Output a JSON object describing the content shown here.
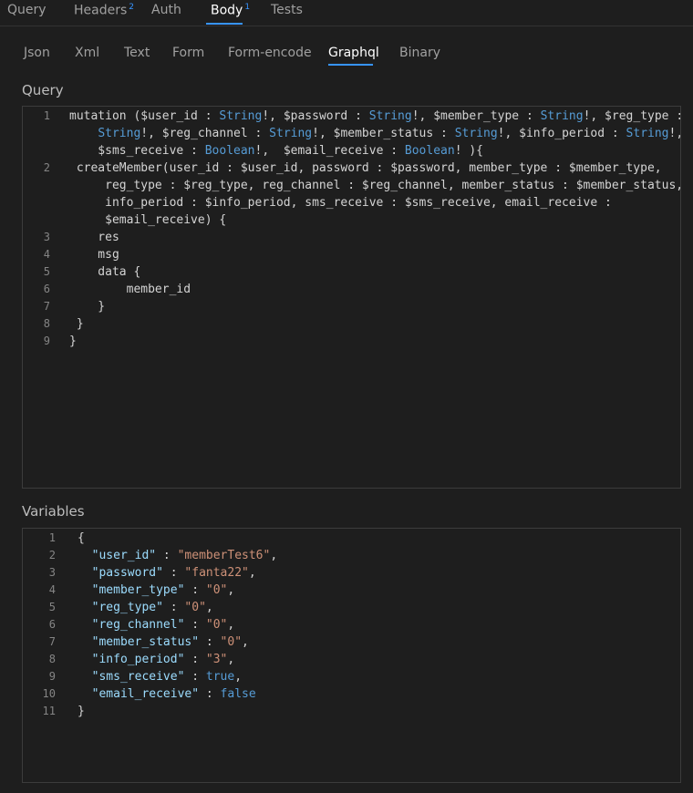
{
  "top_tabs": [
    {
      "label": "Query"
    },
    {
      "label": "Headers",
      "badge": "2"
    },
    {
      "label": "Auth"
    },
    {
      "label": "Body",
      "badge": "1"
    },
    {
      "label": "Tests"
    }
  ],
  "body_tabs": [
    "Json",
    "Xml",
    "Text",
    "Form",
    "Form-encode",
    "Graphql",
    "Binary"
  ],
  "active_body_tab": "Graphql",
  "query_section": {
    "label": "Query",
    "line_numbers": [
      "1",
      "2",
      "3",
      "4",
      "5",
      "6",
      "7",
      "8",
      "9"
    ],
    "rows": [
      "mutation ($user_id : String!, $password : String!, $member_type : String!, $reg_type :",
      "    String!, $reg_channel : String!, $member_status : String!, $info_period : String!,",
      "    $sms_receive : Boolean!,  $email_receive : Boolean! ){",
      " createMember(user_id : $user_id, password : $password, member_type : $member_type,",
      "     reg_type : $reg_type, reg_channel : $reg_channel, member_status : $member_status,",
      "     info_period : $info_period, sms_receive : $sms_receive, email_receive :",
      "     $email_receive) {",
      "    res",
      "    msg",
      "    data {",
      "        member_id",
      "    }",
      " }",
      "}"
    ]
  },
  "variables_section": {
    "label": "Variables",
    "line_numbers": [
      "1",
      "2",
      "3",
      "4",
      "5",
      "6",
      "7",
      "8",
      "9",
      "10",
      "11"
    ],
    "rows": [
      "{",
      "  \"user_id\" : \"memberTest6\",",
      "  \"password\" : \"fanta22\",",
      "  \"member_type\" : \"0\",",
      "  \"reg_type\" : \"0\",",
      "  \"reg_channel\" : \"0\",",
      "  \"member_status\" : \"0\",",
      "  \"info_period\" : \"3\",",
      "  \"sms_receive\" : true,",
      "  \"email_receive\" : false",
      "}"
    ]
  },
  "colors": {
    "accent": "#3794ff",
    "type_keyword": "#569cd6",
    "string": "#ce9178",
    "key": "#9cdcfe"
  }
}
